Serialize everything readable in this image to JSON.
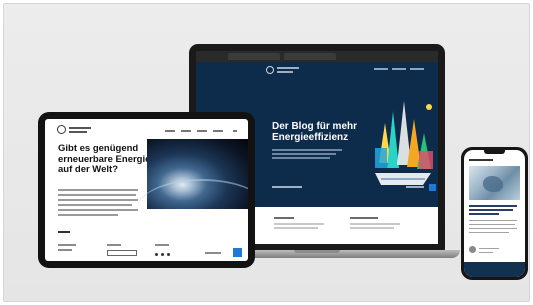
{
  "laptop": {
    "hero_title_line1": "Der Blog für mehr",
    "hero_title_line2": "Energieeffizienz"
  },
  "tablet": {
    "title_line1": "Gibt es genügend",
    "title_line2": "erneuerbare Energie",
    "title_line3": "auf der Welt?"
  },
  "colors": {
    "hero_bg": "#0d2b4a",
    "accent_blue": "#1e7ad6",
    "device_frame": "#121212"
  },
  "icons": [
    "logo-icon",
    "city-illustration",
    "earth-photo",
    "avatar-icon"
  ]
}
